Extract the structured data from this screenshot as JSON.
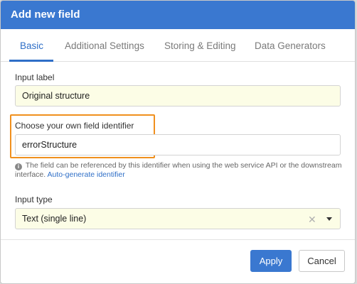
{
  "dialog": {
    "title": "Add new field"
  },
  "tabs": [
    {
      "label": "Basic",
      "active": true
    },
    {
      "label": "Additional Settings",
      "active": false
    },
    {
      "label": "Storing & Editing",
      "active": false
    },
    {
      "label": "Data Generators",
      "active": false
    }
  ],
  "form": {
    "input_label": {
      "label": "Input label",
      "value": "Original structure"
    },
    "field_identifier": {
      "label": "Choose your own field identifier",
      "value": "errorStructure",
      "help_text": "The field can be referenced by this identifier when using the web service API or the downstream interface.",
      "help_link": "Auto-generate identifier"
    },
    "input_type": {
      "label": "Input type",
      "selected": "Text (single line)"
    }
  },
  "footer": {
    "apply_label": "Apply",
    "cancel_label": "Cancel"
  },
  "icons": {
    "info": "info-icon",
    "clear": "clear-icon",
    "dropdown": "caret-down-icon"
  },
  "colors": {
    "header": "#3a78d0",
    "accent": "#2f6fc7",
    "highlight": "#f0901e",
    "input_bg": "#fcfde6"
  }
}
